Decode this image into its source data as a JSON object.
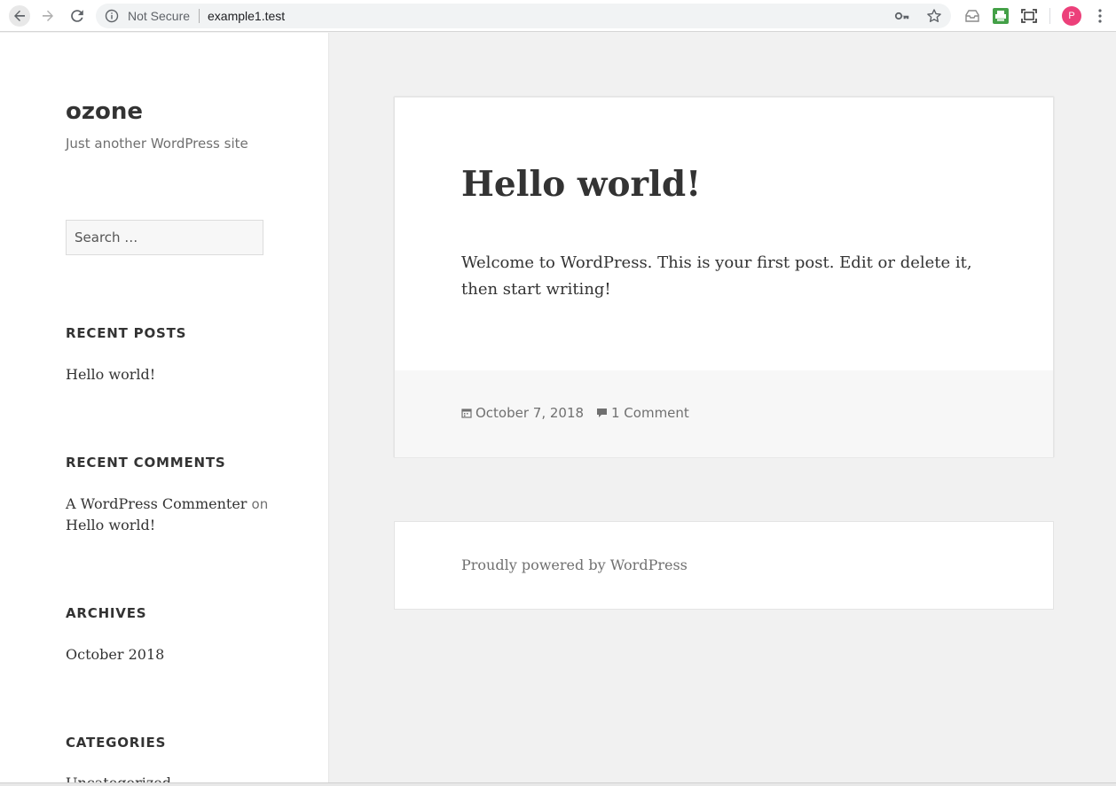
{
  "browser": {
    "security_label": "Not Secure",
    "url": "example1.test",
    "avatar_letter": "P",
    "icons": [
      "back-arrow-icon",
      "forward-arrow-icon",
      "reload-icon",
      "info-icon",
      "key-icon",
      "star-icon",
      "inbox-extension-icon",
      "printer-extension-icon",
      "screenshot-extension-icon",
      "menu-dots-icon"
    ],
    "avatar_color": "#ec407a"
  },
  "site": {
    "title": "ozone",
    "description": "Just another WordPress site"
  },
  "sidebar": {
    "search_placeholder": "Search …",
    "recent_posts": {
      "heading": "RECENT POSTS",
      "items": [
        "Hello world!"
      ]
    },
    "recent_comments": {
      "heading": "RECENT COMMENTS",
      "author": "A WordPress Commenter",
      "on_word": "on",
      "post": "Hello world!"
    },
    "archives": {
      "heading": "ARCHIVES",
      "items": [
        "October 2018"
      ]
    },
    "categories": {
      "heading": "CATEGORIES",
      "items": [
        "Uncategorized"
      ]
    }
  },
  "post": {
    "title": "Hello world!",
    "body": "Welcome to WordPress. This is your first post. Edit or delete it, then start writing!",
    "date": "October 7, 2018",
    "comments": "1 Comment"
  },
  "footer": {
    "text": "Proudly powered by WordPress"
  }
}
